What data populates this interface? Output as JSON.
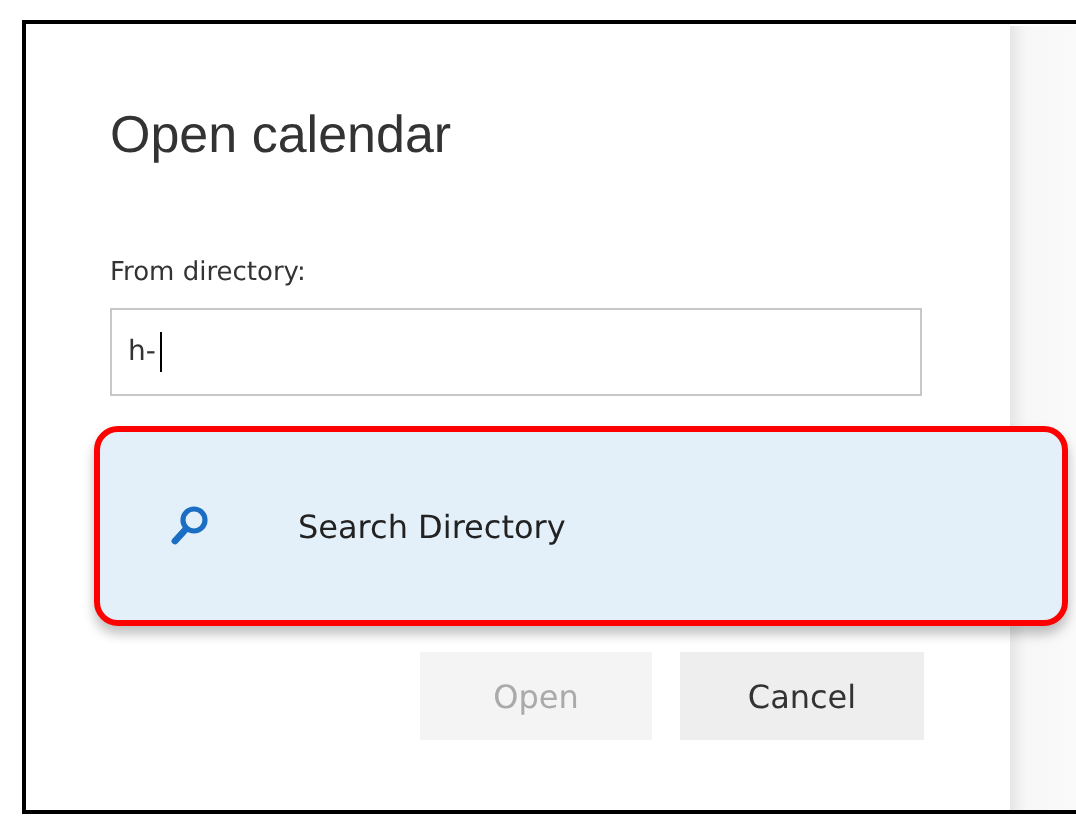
{
  "dialog": {
    "title": "Open calendar",
    "field": {
      "label": "From directory:",
      "value": "h-"
    },
    "suggestions": [
      {
        "label": "Search Directory",
        "highlighted": true
      }
    ],
    "buttons": [
      {
        "label": "Open",
        "disabled": true
      },
      {
        "label": "Cancel",
        "disabled": false
      }
    ]
  }
}
